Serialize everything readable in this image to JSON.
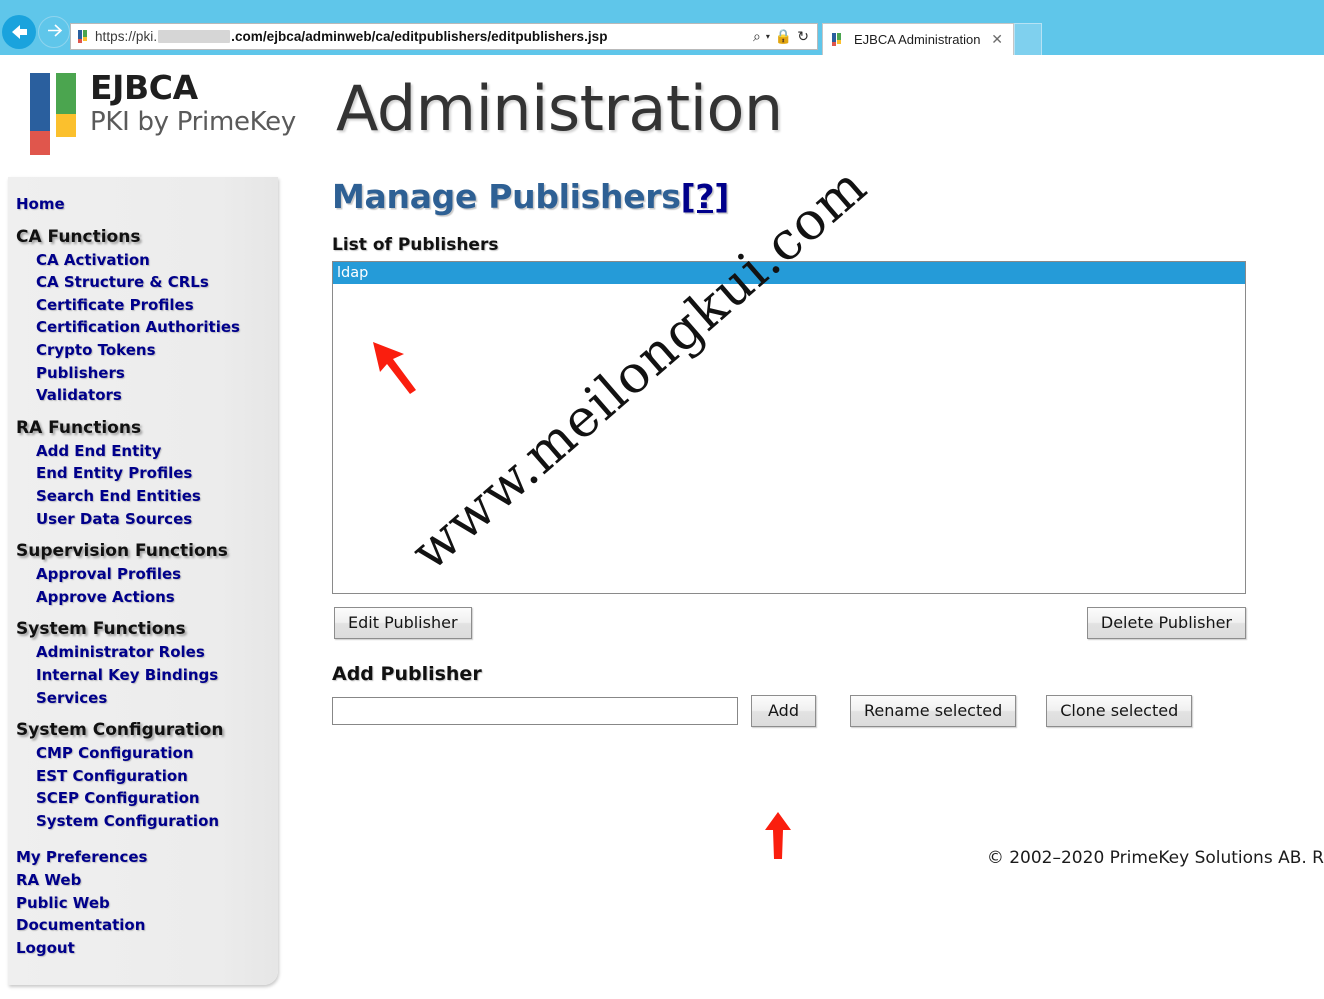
{
  "browser": {
    "back_icon": "back-arrow-icon",
    "forward_icon": "forward-arrow-icon",
    "url_prefix": "https://pki.",
    "url_redacted": "",
    "url_suffix": ".com/ejbca/adminweb/ca/editpublishers/editpublishers.jsp",
    "search_icon": "search-icon",
    "dropdown_caret": "▾",
    "lock_icon": "🔒",
    "refresh_icon": "↻",
    "tab_title": "EJBCA Administration",
    "tab_close": "✕"
  },
  "header": {
    "logo_title": "EJBCA",
    "logo_subtitle": "PKI by PrimeKey",
    "app_title": "Administration"
  },
  "sidebar": {
    "top_link": "Home",
    "groups": [
      {
        "header": "CA Functions",
        "items": [
          "CA Activation",
          "CA Structure & CRLs",
          "Certificate Profiles",
          "Certification Authorities",
          "Crypto Tokens",
          "Publishers",
          "Validators"
        ]
      },
      {
        "header": "RA Functions",
        "items": [
          "Add End Entity",
          "End Entity Profiles",
          "Search End Entities",
          "User Data Sources"
        ]
      },
      {
        "header": "Supervision Functions",
        "items": [
          "Approval Profiles",
          "Approve Actions"
        ]
      },
      {
        "header": "System Functions",
        "items": [
          "Administrator Roles",
          "Internal Key Bindings",
          "Services"
        ]
      },
      {
        "header": "System Configuration",
        "items": [
          "CMP Configuration",
          "EST Configuration",
          "SCEP Configuration",
          "System Configuration"
        ]
      }
    ],
    "bottom_links": [
      "My Preferences",
      "RA Web",
      "Public Web",
      "Documentation",
      "Logout"
    ]
  },
  "main": {
    "page_title": "Manage Publishers",
    "help_link": "[?]",
    "list_section_label": "List of Publishers",
    "publishers": [
      {
        "name": "ldap",
        "selected": true
      }
    ],
    "edit_button": "Edit Publisher",
    "delete_button": "Delete Publisher",
    "add_section_label": "Add Publisher",
    "add_input_value": "",
    "add_input_placeholder": "",
    "add_button": "Add",
    "rename_button": "Rename selected",
    "clone_button": "Clone selected",
    "copyright": "© 2002–2020 PrimeKey Solutions AB. R"
  },
  "watermark": {
    "text": "www.meilongkui.com"
  },
  "annotations": {
    "arrow_color": "#fa1e0e",
    "arrow_list_target": "ldap",
    "arrow_add_target": "Add"
  },
  "colors": {
    "browser_chrome": "#5fc6ea",
    "selection_blue": "#259bd8",
    "title_blue": "#2e6094",
    "link_navy": "#00008b",
    "sidebar_bg": "#ececec"
  }
}
